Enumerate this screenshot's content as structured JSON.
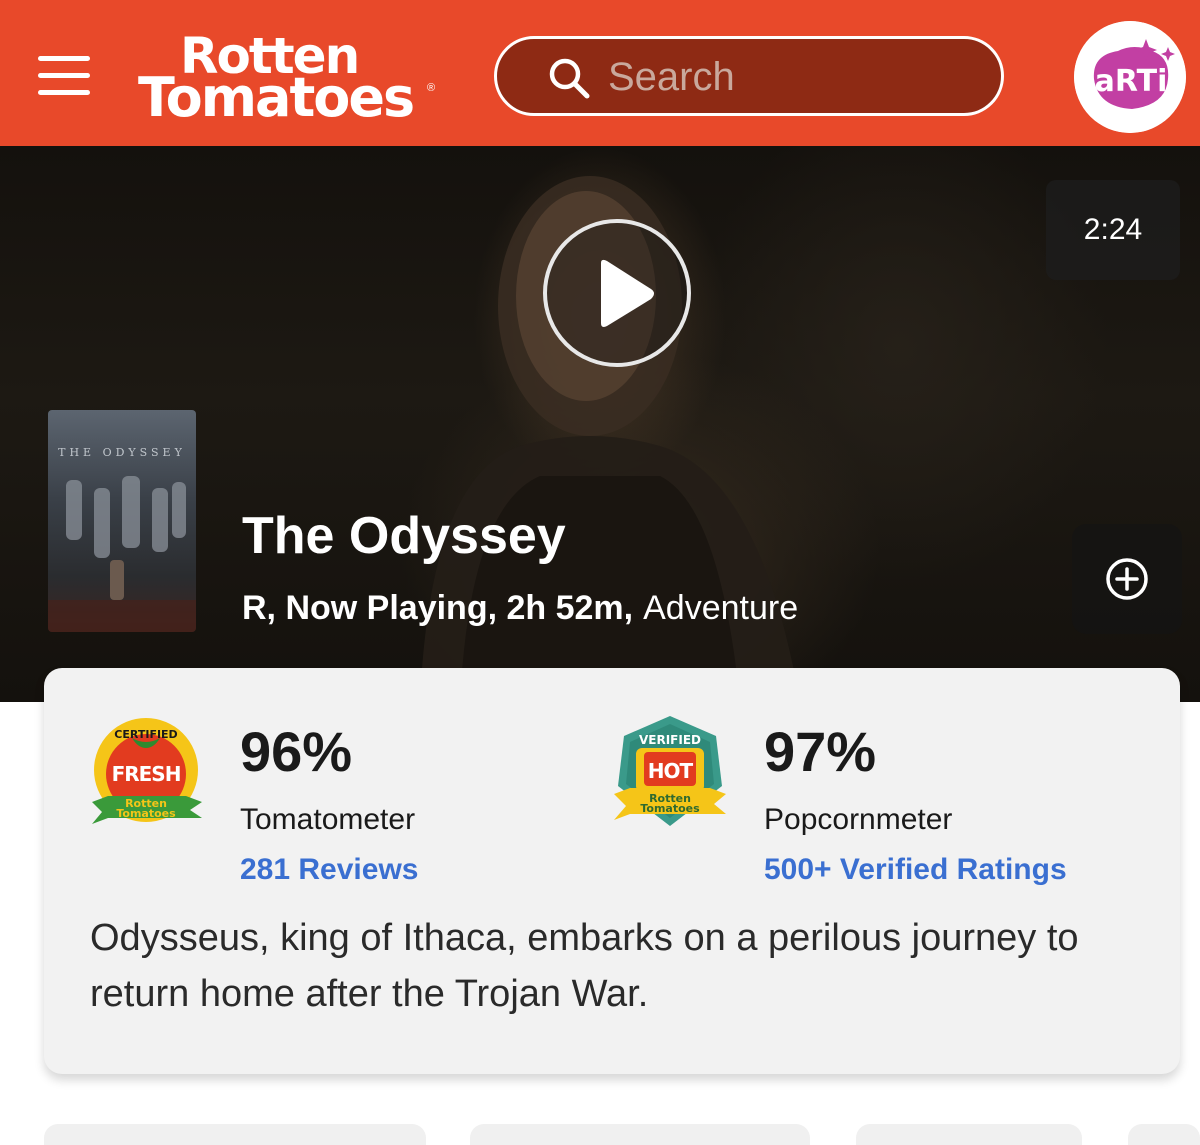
{
  "header": {
    "logo_line1": "Rotten",
    "logo_line2": "Tomatoes",
    "logo_reg": "®",
    "search_placeholder": "Search",
    "avatar_text": "aRTi"
  },
  "hero": {
    "duration": "2:24",
    "poster_title": "THE ODYSSEY",
    "title": "The Odyssey",
    "meta": "R, Now Playing, 2h 52m,",
    "genre": "Adventure"
  },
  "scores": {
    "tomatometer": {
      "badge_top": "CERTIFIED",
      "badge_main": "FRESH",
      "badge_sub1": "Rotten",
      "badge_sub2": "Tomatoes",
      "value": "96%",
      "label": "Tomatometer",
      "link": "281 Reviews"
    },
    "popcornmeter": {
      "badge_top": "VERIFIED",
      "badge_main": "HOT",
      "badge_sub1": "Rotten",
      "badge_sub2": "Tomatoes",
      "value": "97%",
      "label": "Popcornmeter",
      "link": "500+ Verified Ratings"
    }
  },
  "synopsis": "Odysseus, king of Ithaca, embarks on a perilous journey to return home after the Trojan War.",
  "colors": {
    "brand": "#e8492a",
    "link": "#3a6fd1",
    "fresh_red": "#e23b1f",
    "badge_yellow": "#f5c518",
    "badge_green": "#3a9a3a"
  },
  "icons": [
    "menu-icon",
    "search-icon",
    "play-icon",
    "add-circle-icon",
    "certified-fresh-icon",
    "verified-hot-icon"
  ]
}
